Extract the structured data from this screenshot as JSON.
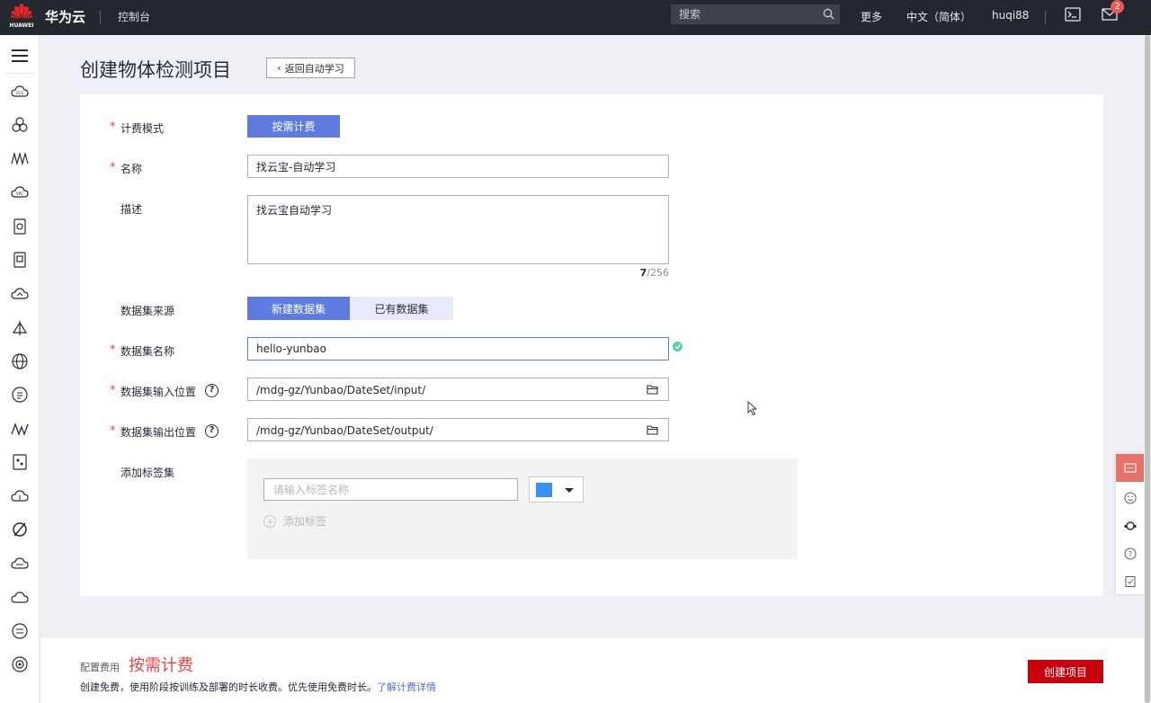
{
  "topbar": {
    "logo_text": "HUAWEI",
    "brand": "华为云",
    "console": "控制台",
    "search_placeholder": "搜索",
    "more": "更多",
    "language": "中文（简体）",
    "username": "huqi88",
    "mail_badge": "2"
  },
  "page": {
    "title": "创建物体检测项目",
    "back_label": "返回自动学习"
  },
  "form": {
    "billing_label": "计费模式",
    "billing_value": "按需计费",
    "name_label": "名称",
    "name_value": "找云宝-自动学习",
    "desc_label": "描述",
    "desc_value": "找云宝自动学习",
    "desc_count": "7",
    "desc_max": "/256",
    "source_label": "数据集来源",
    "source_new": "新建数据集",
    "source_existing": "已有数据集",
    "dataset_name_label": "数据集名称",
    "dataset_name_value": "hello-yunbao",
    "input_path_label": "数据集输入位置",
    "input_path_value": "/mdg-gz/Yunbao/DateSet/input/",
    "output_path_label": "数据集输出位置",
    "output_path_value": "/mdg-gz/Yunbao/DateSet/output/",
    "tags_label": "添加标签集",
    "tag_placeholder": "请输入标签名称",
    "tag_color": "#3892f5",
    "add_tag": "添加标签"
  },
  "footer": {
    "fee_label": "配置费用",
    "fee_value": "按需计费",
    "fee_desc": "创建免费，使用阶段按训练及部署的时长收费。优先使用免费时长。",
    "fee_link": "了解计费详情",
    "create_button": "创建项目"
  },
  "colors": {
    "primary": "#5e7ce0",
    "danger": "#c7000b",
    "topbar": "#23272e"
  }
}
